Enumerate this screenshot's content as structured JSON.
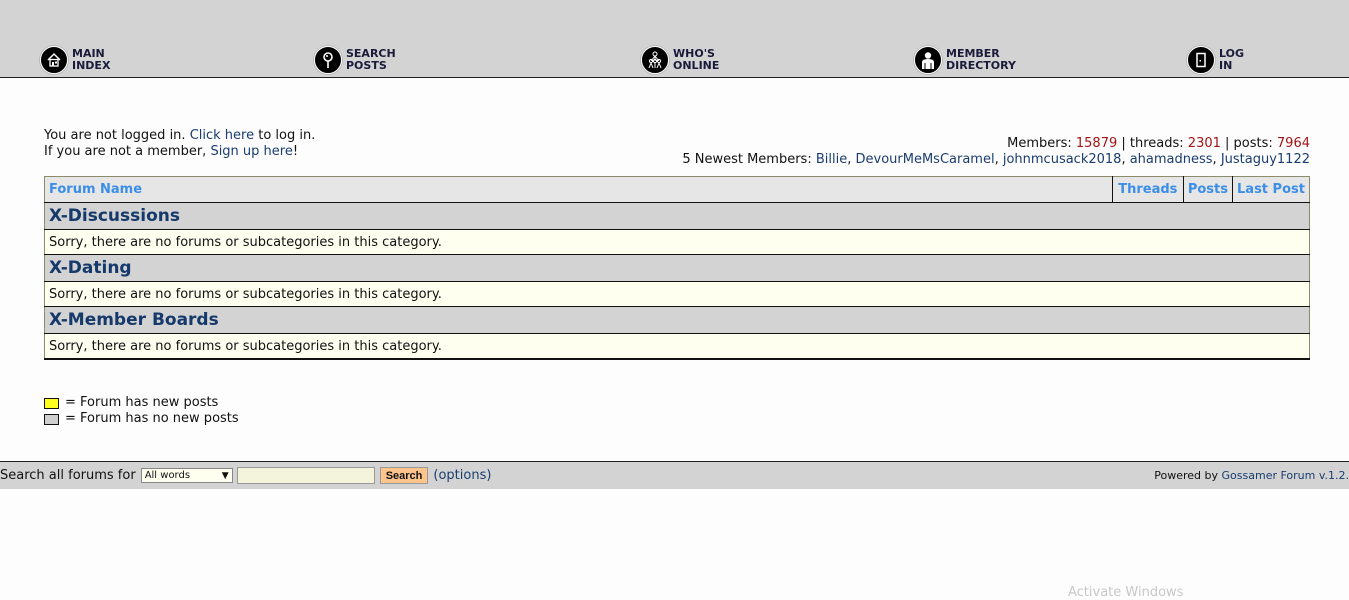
{
  "nav": {
    "items": [
      {
        "line1": "MAIN",
        "line2": "INDEX",
        "icon": "house-icon"
      },
      {
        "line1": "SEARCH",
        "line2": "POSTS",
        "icon": "magnifier-icon"
      },
      {
        "line1": "WHO'S",
        "line2": "ONLINE",
        "icon": "people-tree-icon"
      },
      {
        "line1": "MEMBER",
        "line2": "DIRECTORY",
        "icon": "person-silhouette-icon"
      },
      {
        "line1": "LOG",
        "line2": "IN",
        "icon": "door-icon"
      }
    ]
  },
  "login": {
    "line1_prefix": "You are not logged in. ",
    "click_here": "Click here",
    "line1_suffix": " to log in.",
    "line2_prefix": "If you are not a member, ",
    "sign_up": "Sign up here",
    "line2_suffix": "!"
  },
  "stats": {
    "members_label": "Members: ",
    "members": "15879",
    "threads_label": " | threads: ",
    "threads": "2301",
    "posts_label": " | posts: ",
    "posts": "7964",
    "newest_label": "5 Newest Members: ",
    "newest": [
      "Billie",
      "DevourMeMsCaramel",
      "johnmcusack2018",
      "ahamadness",
      "Justaguy1122"
    ]
  },
  "table": {
    "headers": {
      "forum_name": "Forum Name",
      "threads": "Threads",
      "posts": "Posts",
      "last_post": "Last Post"
    },
    "categories": [
      {
        "name": "X-Discussions",
        "message": "Sorry, there are no forums or subcategories in this category."
      },
      {
        "name": "X-Dating",
        "message": "Sorry, there are no forums or subcategories in this category."
      },
      {
        "name": "X-Member Boards",
        "message": "Sorry, there are no forums or subcategories in this category."
      }
    ]
  },
  "legend": {
    "new_posts": "= Forum has new posts",
    "no_new_posts": "= Forum has no new posts"
  },
  "footer": {
    "search_label": "Search all forums for",
    "select_value": "All words",
    "search_value": "",
    "search_button": "Search",
    "options_link": "(options)",
    "powered_prefix": "Powered by ",
    "powered_link": "Gossamer Forum v.1.2."
  },
  "watermark": "Activate Windows"
}
